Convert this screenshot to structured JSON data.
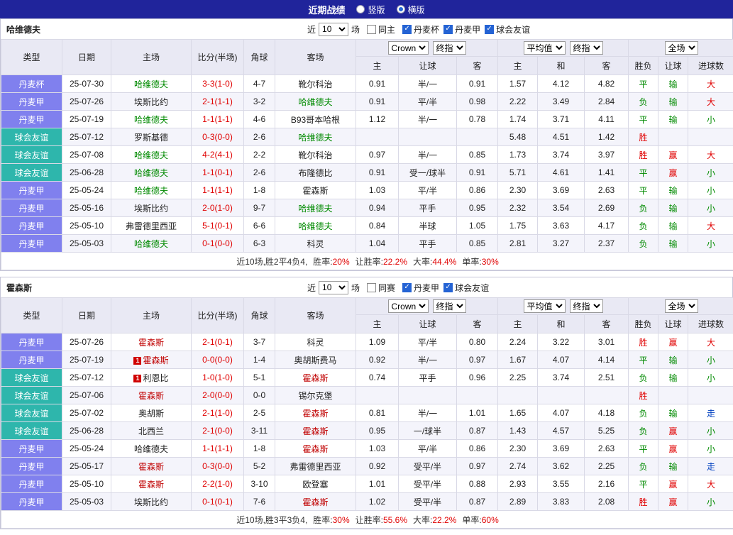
{
  "colors": {
    "title_bar_bg": "#20249B",
    "header_bg": "#E9E9F4",
    "league_type_bg": "#8080EE",
    "friendly_type_bg": "#2EB6AC",
    "focus_team_green": "#008A00",
    "focus_team_red": "#C00000",
    "score_red": "#E00000",
    "win_red": "#E00000",
    "loss_green": "#008A00",
    "push_blue": "#0040C0",
    "alt_row_bg": "#F4F4FB",
    "checkbox_blue": "#2463D4"
  },
  "title_bar": {
    "title": "近期战绩",
    "vertical_label": "竖版",
    "horizontal_label": "横版",
    "selected": "横版"
  },
  "tables": [
    {
      "team": "哈维德夫",
      "filters": {
        "recent": "近",
        "count": "10",
        "unit": "场",
        "same": {
          "label": "同主",
          "checked": false
        },
        "leagues": [
          {
            "label": "丹麦杯",
            "checked": true
          },
          {
            "label": "丹麦甲",
            "checked": true
          },
          {
            "label": "球会友谊",
            "checked": true
          }
        ]
      },
      "dropdowns": {
        "bookmaker": "Crown",
        "stage1": "终指",
        "average": "平均值",
        "stage2": "终指",
        "scope": "全场"
      },
      "columns": [
        "类型",
        "日期",
        "主场",
        "比分(半场)",
        "角球",
        "客场",
        "主",
        "让球",
        "客",
        "主",
        "和",
        "客",
        "胜负",
        "让球",
        "进球数"
      ],
      "rows": [
        {
          "type": "丹麦杯",
          "tcls": "league",
          "date": "25-07-30",
          "home": {
            "name": "哈维德夫",
            "cls": "green",
            "badge": ""
          },
          "score": "3-3(1-0)",
          "corner": "4-7",
          "away": {
            "name": "靴尔科治",
            "cls": "",
            "badge": ""
          },
          "odds": [
            "0.91",
            "半/一",
            "0.91"
          ],
          "avg": [
            "1.57",
            "4.12",
            "4.82"
          ],
          "res": {
            "t": "平",
            "c": "green"
          },
          "let": {
            "t": "输",
            "c": "green"
          },
          "goal": {
            "t": "大",
            "c": "red"
          }
        },
        {
          "type": "丹麦甲",
          "tcls": "league",
          "date": "25-07-26",
          "home": {
            "name": "埃斯比约",
            "cls": "",
            "badge": ""
          },
          "score": "2-1(1-1)",
          "corner": "3-2",
          "away": {
            "name": "哈维德夫",
            "cls": "green",
            "badge": ""
          },
          "odds": [
            "0.91",
            "平/半",
            "0.98"
          ],
          "avg": [
            "2.22",
            "3.49",
            "2.84"
          ],
          "res": {
            "t": "负",
            "c": "green"
          },
          "let": {
            "t": "输",
            "c": "green"
          },
          "goal": {
            "t": "大",
            "c": "red"
          }
        },
        {
          "type": "丹麦甲",
          "tcls": "league",
          "date": "25-07-19",
          "home": {
            "name": "哈维德夫",
            "cls": "green",
            "badge": ""
          },
          "score": "1-1(1-1)",
          "corner": "4-6",
          "away": {
            "name": "B93哥本哈根",
            "cls": "",
            "badge": ""
          },
          "odds": [
            "1.12",
            "半/一",
            "0.78"
          ],
          "avg": [
            "1.74",
            "3.71",
            "4.11"
          ],
          "res": {
            "t": "平",
            "c": "green"
          },
          "let": {
            "t": "输",
            "c": "green"
          },
          "goal": {
            "t": "小",
            "c": "green"
          }
        },
        {
          "type": "球会友谊",
          "tcls": "friendly",
          "date": "25-07-12",
          "home": {
            "name": "罗斯基德",
            "cls": "",
            "badge": ""
          },
          "score": "0-3(0-0)",
          "corner": "2-6",
          "away": {
            "name": "哈维德夫",
            "cls": "green",
            "badge": ""
          },
          "odds": [
            "",
            "",
            ""
          ],
          "avg": [
            "5.48",
            "4.51",
            "1.42"
          ],
          "res": {
            "t": "胜",
            "c": "red"
          },
          "let": {
            "t": "",
            "c": ""
          },
          "goal": {
            "t": "",
            "c": ""
          }
        },
        {
          "type": "球会友谊",
          "tcls": "friendly",
          "date": "25-07-08",
          "home": {
            "name": "哈维德夫",
            "cls": "green",
            "badge": ""
          },
          "score": "4-2(4-1)",
          "corner": "2-2",
          "away": {
            "name": "靴尔科治",
            "cls": "",
            "badge": ""
          },
          "odds": [
            "0.97",
            "半/一",
            "0.85"
          ],
          "avg": [
            "1.73",
            "3.74",
            "3.97"
          ],
          "res": {
            "t": "胜",
            "c": "red"
          },
          "let": {
            "t": "赢",
            "c": "red"
          },
          "goal": {
            "t": "大",
            "c": "red"
          }
        },
        {
          "type": "球会友谊",
          "tcls": "friendly",
          "date": "25-06-28",
          "home": {
            "name": "哈维德夫",
            "cls": "green",
            "badge": ""
          },
          "score": "1-1(0-1)",
          "corner": "2-6",
          "away": {
            "name": "布隆德比",
            "cls": "",
            "badge": ""
          },
          "odds": [
            "0.91",
            "受一/球半",
            "0.91"
          ],
          "avg": [
            "5.71",
            "4.61",
            "1.41"
          ],
          "res": {
            "t": "平",
            "c": "green"
          },
          "let": {
            "t": "赢",
            "c": "red"
          },
          "goal": {
            "t": "小",
            "c": "green"
          }
        },
        {
          "type": "丹麦甲",
          "tcls": "league",
          "date": "25-05-24",
          "home": {
            "name": "哈维德夫",
            "cls": "green",
            "badge": ""
          },
          "score": "1-1(1-1)",
          "corner": "1-8",
          "away": {
            "name": "霍森斯",
            "cls": "",
            "badge": ""
          },
          "odds": [
            "1.03",
            "平/半",
            "0.86"
          ],
          "avg": [
            "2.30",
            "3.69",
            "2.63"
          ],
          "res": {
            "t": "平",
            "c": "green"
          },
          "let": {
            "t": "输",
            "c": "green"
          },
          "goal": {
            "t": "小",
            "c": "green"
          }
        },
        {
          "type": "丹麦甲",
          "tcls": "league",
          "date": "25-05-16",
          "home": {
            "name": "埃斯比约",
            "cls": "",
            "badge": ""
          },
          "score": "2-0(1-0)",
          "corner": "9-7",
          "away": {
            "name": "哈维德夫",
            "cls": "green",
            "badge": ""
          },
          "odds": [
            "0.94",
            "平手",
            "0.95"
          ],
          "avg": [
            "2.32",
            "3.54",
            "2.69"
          ],
          "res": {
            "t": "负",
            "c": "green"
          },
          "let": {
            "t": "输",
            "c": "green"
          },
          "goal": {
            "t": "小",
            "c": "green"
          }
        },
        {
          "type": "丹麦甲",
          "tcls": "league",
          "date": "25-05-10",
          "home": {
            "name": "弗雷德里西亚",
            "cls": "",
            "badge": ""
          },
          "score": "5-1(0-1)",
          "corner": "6-6",
          "away": {
            "name": "哈维德夫",
            "cls": "green",
            "badge": ""
          },
          "odds": [
            "0.84",
            "半球",
            "1.05"
          ],
          "avg": [
            "1.75",
            "3.63",
            "4.17"
          ],
          "res": {
            "t": "负",
            "c": "green"
          },
          "let": {
            "t": "输",
            "c": "green"
          },
          "goal": {
            "t": "大",
            "c": "red"
          }
        },
        {
          "type": "丹麦甲",
          "tcls": "league",
          "date": "25-05-03",
          "home": {
            "name": "哈维德夫",
            "cls": "green",
            "badge": ""
          },
          "score": "0-1(0-0)",
          "corner": "6-3",
          "away": {
            "name": "科灵",
            "cls": "",
            "badge": ""
          },
          "odds": [
            "1.04",
            "平手",
            "0.85"
          ],
          "avg": [
            "2.81",
            "3.27",
            "2.37"
          ],
          "res": {
            "t": "负",
            "c": "green"
          },
          "let": {
            "t": "输",
            "c": "green"
          },
          "goal": {
            "t": "小",
            "c": "green"
          }
        }
      ],
      "summary": {
        "prefix": "近10场,胜2平4负4,",
        "stats": [
          {
            "label": "胜率:",
            "value": "20%"
          },
          {
            "label": "让胜率:",
            "value": "22.2%"
          },
          {
            "label": "大率:",
            "value": "44.4%"
          },
          {
            "label": "单率:",
            "value": "30%"
          }
        ]
      }
    },
    {
      "team": "霍森斯",
      "filters": {
        "recent": "近",
        "count": "10",
        "unit": "场",
        "same": {
          "label": "同赛",
          "checked": false
        },
        "leagues": [
          {
            "label": "丹麦甲",
            "checked": true
          },
          {
            "label": "球会友谊",
            "checked": true
          }
        ]
      },
      "dropdowns": {
        "bookmaker": "Crown",
        "stage1": "终指",
        "average": "平均值",
        "stage2": "终指",
        "scope": "全场"
      },
      "columns": [
        "类型",
        "日期",
        "主场",
        "比分(半场)",
        "角球",
        "客场",
        "主",
        "让球",
        "客",
        "主",
        "和",
        "客",
        "胜负",
        "让球",
        "进球数"
      ],
      "rows": [
        {
          "type": "丹麦甲",
          "tcls": "league",
          "date": "25-07-26",
          "home": {
            "name": "霍森斯",
            "cls": "red",
            "badge": ""
          },
          "score": "2-1(0-1)",
          "corner": "3-7",
          "away": {
            "name": "科灵",
            "cls": "",
            "badge": ""
          },
          "odds": [
            "1.09",
            "平/半",
            "0.80"
          ],
          "avg": [
            "2.24",
            "3.22",
            "3.01"
          ],
          "res": {
            "t": "胜",
            "c": "red"
          },
          "let": {
            "t": "赢",
            "c": "red"
          },
          "goal": {
            "t": "大",
            "c": "red"
          }
        },
        {
          "type": "丹麦甲",
          "tcls": "league",
          "date": "25-07-19",
          "home": {
            "name": "霍森斯",
            "cls": "red",
            "badge": "1"
          },
          "score": "0-0(0-0)",
          "corner": "1-4",
          "away": {
            "name": "奥胡斯费马",
            "cls": "",
            "badge": ""
          },
          "odds": [
            "0.92",
            "半/一",
            "0.97"
          ],
          "avg": [
            "1.67",
            "4.07",
            "4.14"
          ],
          "res": {
            "t": "平",
            "c": "green"
          },
          "let": {
            "t": "输",
            "c": "green"
          },
          "goal": {
            "t": "小",
            "c": "green"
          }
        },
        {
          "type": "球会友谊",
          "tcls": "friendly",
          "date": "25-07-12",
          "home": {
            "name": "利恩比",
            "cls": "",
            "badge": "1"
          },
          "score": "1-0(1-0)",
          "corner": "5-1",
          "away": {
            "name": "霍森斯",
            "cls": "red",
            "badge": ""
          },
          "odds": [
            "0.74",
            "平手",
            "0.96"
          ],
          "avg": [
            "2.25",
            "3.74",
            "2.51"
          ],
          "res": {
            "t": "负",
            "c": "green"
          },
          "let": {
            "t": "输",
            "c": "green"
          },
          "goal": {
            "t": "小",
            "c": "green"
          }
        },
        {
          "type": "球会友谊",
          "tcls": "friendly",
          "date": "25-07-06",
          "home": {
            "name": "霍森斯",
            "cls": "red",
            "badge": ""
          },
          "score": "2-0(0-0)",
          "corner": "0-0",
          "away": {
            "name": "锡尔克堡",
            "cls": "",
            "badge": ""
          },
          "odds": [
            "",
            "",
            ""
          ],
          "avg": [
            "",
            "",
            ""
          ],
          "res": {
            "t": "胜",
            "c": "red"
          },
          "let": {
            "t": "",
            "c": ""
          },
          "goal": {
            "t": "",
            "c": ""
          }
        },
        {
          "type": "球会友谊",
          "tcls": "friendly",
          "date": "25-07-02",
          "home": {
            "name": "奥胡斯",
            "cls": "",
            "badge": ""
          },
          "score": "2-1(1-0)",
          "corner": "2-5",
          "away": {
            "name": "霍森斯",
            "cls": "red",
            "badge": ""
          },
          "odds": [
            "0.81",
            "半/一",
            "1.01"
          ],
          "avg": [
            "1.65",
            "4.07",
            "4.18"
          ],
          "res": {
            "t": "负",
            "c": "green"
          },
          "let": {
            "t": "输",
            "c": "green"
          },
          "goal": {
            "t": "走",
            "c": "blue"
          }
        },
        {
          "type": "球会友谊",
          "tcls": "friendly",
          "date": "25-06-28",
          "home": {
            "name": "北西兰",
            "cls": "",
            "badge": ""
          },
          "score": "2-1(0-0)",
          "corner": "3-11",
          "away": {
            "name": "霍森斯",
            "cls": "red",
            "badge": ""
          },
          "odds": [
            "0.95",
            "一/球半",
            "0.87"
          ],
          "avg": [
            "1.43",
            "4.57",
            "5.25"
          ],
          "res": {
            "t": "负",
            "c": "green"
          },
          "let": {
            "t": "赢",
            "c": "red"
          },
          "goal": {
            "t": "小",
            "c": "green"
          }
        },
        {
          "type": "丹麦甲",
          "tcls": "league",
          "date": "25-05-24",
          "home": {
            "name": "哈维德夫",
            "cls": "",
            "badge": ""
          },
          "score": "1-1(1-1)",
          "corner": "1-8",
          "away": {
            "name": "霍森斯",
            "cls": "red",
            "badge": ""
          },
          "odds": [
            "1.03",
            "平/半",
            "0.86"
          ],
          "avg": [
            "2.30",
            "3.69",
            "2.63"
          ],
          "res": {
            "t": "平",
            "c": "green"
          },
          "let": {
            "t": "赢",
            "c": "red"
          },
          "goal": {
            "t": "小",
            "c": "green"
          }
        },
        {
          "type": "丹麦甲",
          "tcls": "league",
          "date": "25-05-17",
          "home": {
            "name": "霍森斯",
            "cls": "red",
            "badge": ""
          },
          "score": "0-3(0-0)",
          "corner": "5-2",
          "away": {
            "name": "弗雷德里西亚",
            "cls": "",
            "badge": ""
          },
          "odds": [
            "0.92",
            "受平/半",
            "0.97"
          ],
          "avg": [
            "2.74",
            "3.62",
            "2.25"
          ],
          "res": {
            "t": "负",
            "c": "green"
          },
          "let": {
            "t": "输",
            "c": "green"
          },
          "goal": {
            "t": "走",
            "c": "blue"
          }
        },
        {
          "type": "丹麦甲",
          "tcls": "league",
          "date": "25-05-10",
          "home": {
            "name": "霍森斯",
            "cls": "red",
            "badge": ""
          },
          "score": "2-2(1-0)",
          "corner": "3-10",
          "away": {
            "name": "欧登塞",
            "cls": "",
            "badge": ""
          },
          "odds": [
            "1.01",
            "受平/半",
            "0.88"
          ],
          "avg": [
            "2.93",
            "3.55",
            "2.16"
          ],
          "res": {
            "t": "平",
            "c": "green"
          },
          "let": {
            "t": "赢",
            "c": "red"
          },
          "goal": {
            "t": "大",
            "c": "red"
          }
        },
        {
          "type": "丹麦甲",
          "tcls": "league",
          "date": "25-05-03",
          "home": {
            "name": "埃斯比约",
            "cls": "",
            "badge": ""
          },
          "score": "0-1(0-1)",
          "corner": "7-6",
          "away": {
            "name": "霍森斯",
            "cls": "red",
            "badge": ""
          },
          "odds": [
            "1.02",
            "受平/半",
            "0.87"
          ],
          "avg": [
            "2.89",
            "3.83",
            "2.08"
          ],
          "res": {
            "t": "胜",
            "c": "red"
          },
          "let": {
            "t": "赢",
            "c": "red"
          },
          "goal": {
            "t": "小",
            "c": "green"
          }
        }
      ],
      "summary": {
        "prefix": "近10场,胜3平3负4,",
        "stats": [
          {
            "label": "胜率:",
            "value": "30%"
          },
          {
            "label": "让胜率:",
            "value": "55.6%"
          },
          {
            "label": "大率:",
            "value": "22.2%"
          },
          {
            "label": "单率:",
            "value": "60%"
          }
        ]
      }
    }
  ]
}
